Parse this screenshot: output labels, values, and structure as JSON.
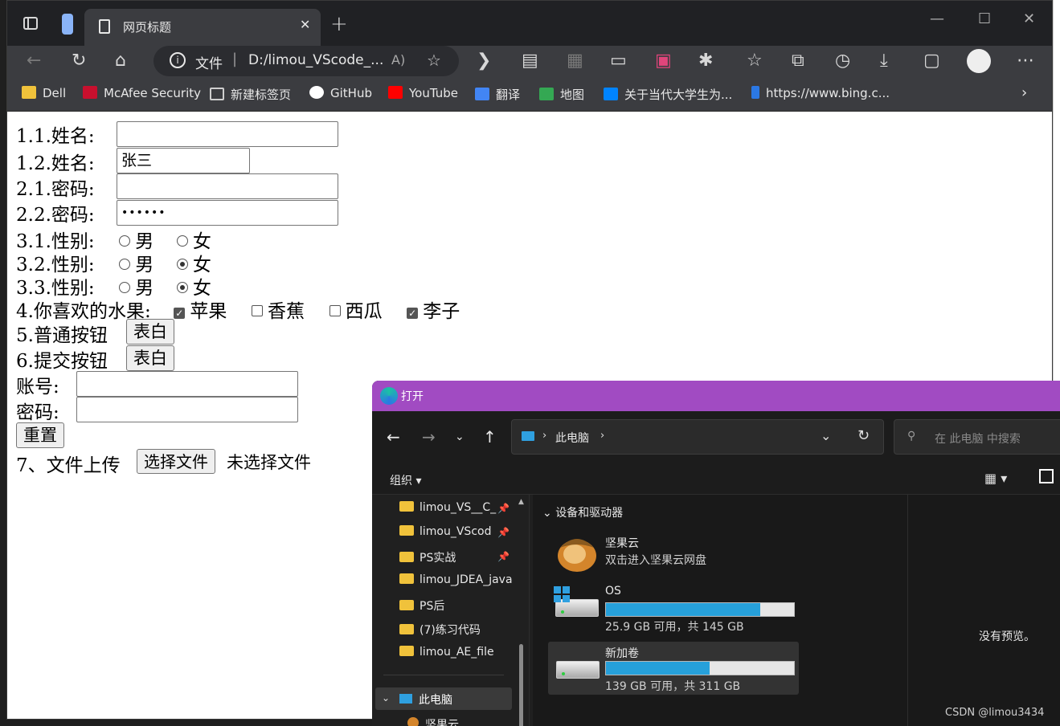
{
  "browser": {
    "tab_title": "网页标题",
    "address": {
      "scheme_label": "文件",
      "url": "D:/limou_VScode_..."
    },
    "bookmarks": [
      {
        "label": "Dell",
        "color": "#f0c23b"
      },
      {
        "label": "McAfee Security",
        "color": "#c8102e"
      },
      {
        "label": "新建标签页",
        "color": "#cfcfcf"
      },
      {
        "label": "GitHub",
        "color": "#ffffff"
      },
      {
        "label": "YouTube",
        "color": "#ff0000"
      },
      {
        "label": "翻译",
        "color": "#4285f4"
      },
      {
        "label": "地图",
        "color": "#34a853"
      },
      {
        "label": "关于当代大学生为...",
        "color": "#0084ff"
      },
      {
        "label": "https://www.bing.c...",
        "color": "#2b78e4"
      }
    ]
  },
  "form": {
    "row1_label": "1.1.姓名:",
    "row1_value": "",
    "row2_label": "1.2.姓名:",
    "row2_value": "张三",
    "row3_label": "2.1.密码:",
    "row3_value": "",
    "row4_label": "2.2.密码:",
    "row4_value": "••••••",
    "gender_rows": [
      {
        "label": "3.1.性别:",
        "male": "男",
        "female": "女",
        "selected": "none"
      },
      {
        "label": "3.2.性别:",
        "male": "男",
        "female": "女",
        "selected": "female"
      },
      {
        "label": "3.3.性别:",
        "male": "男",
        "female": "女",
        "selected": "female"
      }
    ],
    "fruit_label": "4.你喜欢的水果:",
    "fruits": [
      {
        "label": "苹果",
        "checked": true
      },
      {
        "label": "香蕉",
        "checked": false
      },
      {
        "label": "西瓜",
        "checked": false
      },
      {
        "label": "李子",
        "checked": true
      }
    ],
    "row5_label": "5.普通按钮",
    "row5_button": "表白",
    "row6_label": "6.提交按钮",
    "row6_button": "表白",
    "account_label": "账号:",
    "password_label": "密码:",
    "reset_button": "重置",
    "upload_label": "7、文件上传",
    "upload_button": "选择文件",
    "upload_status": "未选择文件"
  },
  "dialog": {
    "title": "打开",
    "breadcrumb": "此电脑",
    "search_placeholder": "在 此电脑 中搜索",
    "organize": "组织",
    "nav_items": [
      "limou_VS__C_",
      "limou_VScod",
      "PS实战",
      "limou_JDEA_java",
      "PS后",
      "(7)练习代码",
      "limou_AE_file"
    ],
    "this_pc": "此电脑",
    "nuts_cloud_nav": "坚果云",
    "group_title": "设备和驱动器",
    "drives": [
      {
        "name": "坚果云",
        "subtitle": "双击进入坚果云网盘"
      },
      {
        "name": "OS",
        "subtitle": "25.9 GB 可用，共 145 GB",
        "used_fraction": 0.82
      },
      {
        "name": "新加卷",
        "subtitle": "139 GB 可用，共 311 GB",
        "used_fraction": 0.55
      }
    ],
    "preview_text": "没有预览。"
  },
  "watermark": "CSDN @limou3434"
}
